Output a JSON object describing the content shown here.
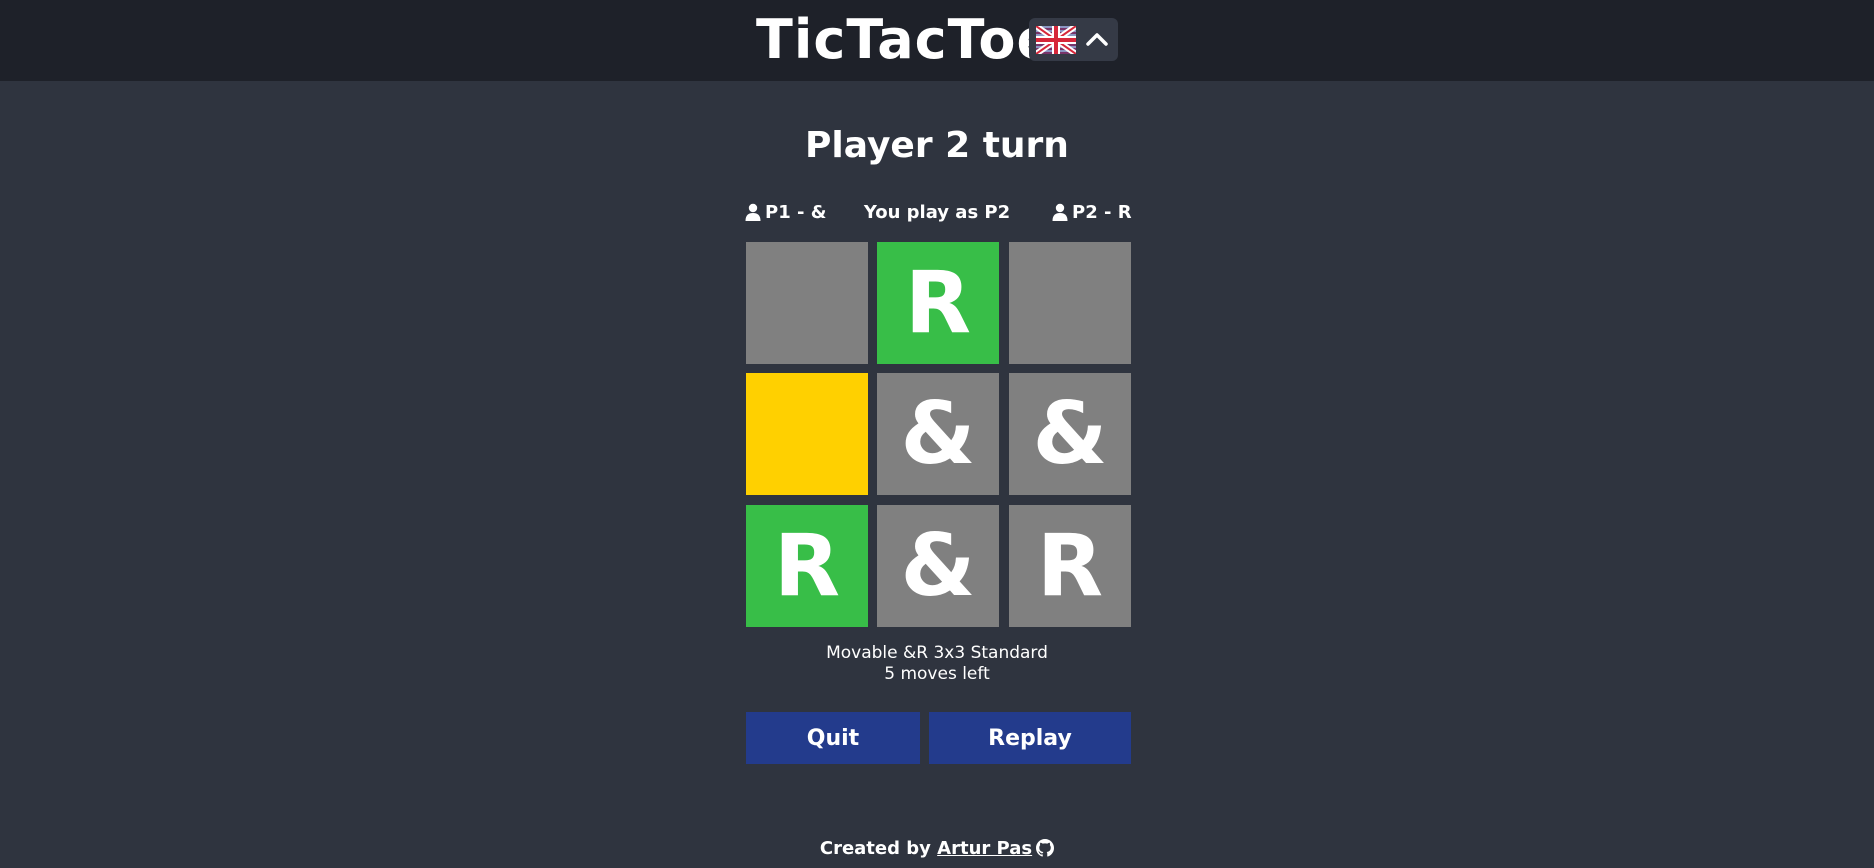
{
  "header": {
    "title": "TicTacToe",
    "language_icon": "uk-flag-icon",
    "language_toggle_icon": "chevron-up-icon"
  },
  "game": {
    "status": "Player 2 turn",
    "players": {
      "p1": "P1 - &",
      "you": "You play as P2",
      "p2": "P2 - R",
      "icon": "user-icon"
    },
    "board": [
      {
        "value": "",
        "state": "empty"
      },
      {
        "value": "R",
        "state": "highlighted"
      },
      {
        "value": "",
        "state": "empty"
      },
      {
        "value": "",
        "state": "selected"
      },
      {
        "value": "&",
        "state": "normal"
      },
      {
        "value": "&",
        "state": "normal"
      },
      {
        "value": "R",
        "state": "highlighted"
      },
      {
        "value": "&",
        "state": "normal"
      },
      {
        "value": "R",
        "state": "normal"
      }
    ],
    "mode": "Movable &R 3x3 Standard",
    "moves_left": "5 moves left"
  },
  "actions": {
    "quit": "Quit",
    "replay": "Replay"
  },
  "footer": {
    "created_by": "Created by",
    "author": "Artur Pas",
    "repo_icon": "github-icon"
  },
  "colors": {
    "background": "#2f343f",
    "header_background": "#1e2129",
    "cell_normal": "#808080",
    "cell_highlighted": "#38be48",
    "cell_selected": "#ffd000",
    "button": "#233b8c"
  }
}
